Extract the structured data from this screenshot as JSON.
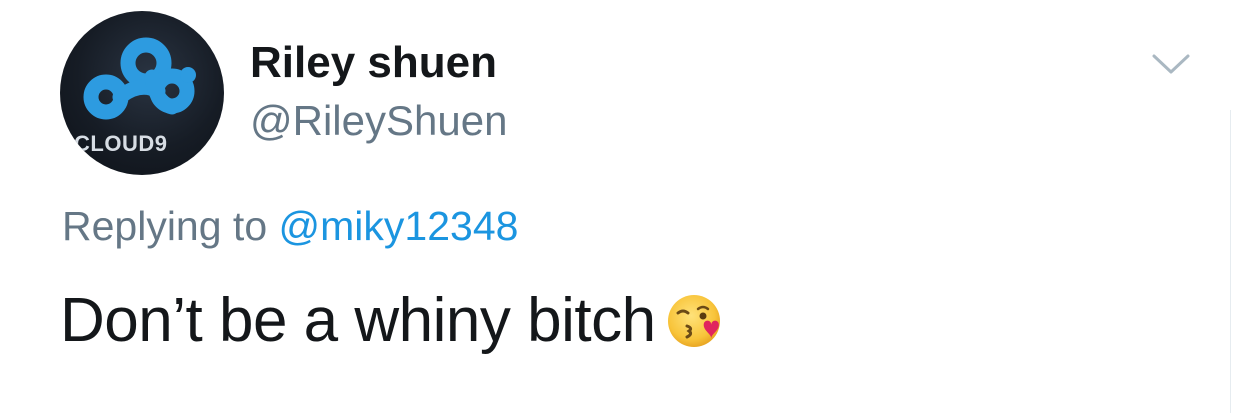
{
  "author": {
    "display_name": "Riley shuen",
    "handle": "@RileyShuen",
    "avatar_text": "CLOUD9",
    "avatar_icon": "cloud9-logo"
  },
  "reply": {
    "prefix": "Replying to",
    "mention": "@miky12348"
  },
  "tweet": {
    "text": "Don’t be a whiny bitch",
    "emoji": "face-blowing-a-kiss"
  },
  "menu": {
    "icon": "chevron-down-icon"
  },
  "colors": {
    "text_primary": "#14171a",
    "text_secondary": "#657786",
    "link": "#1b95e0",
    "avatar_logo": "#2d9be0"
  }
}
